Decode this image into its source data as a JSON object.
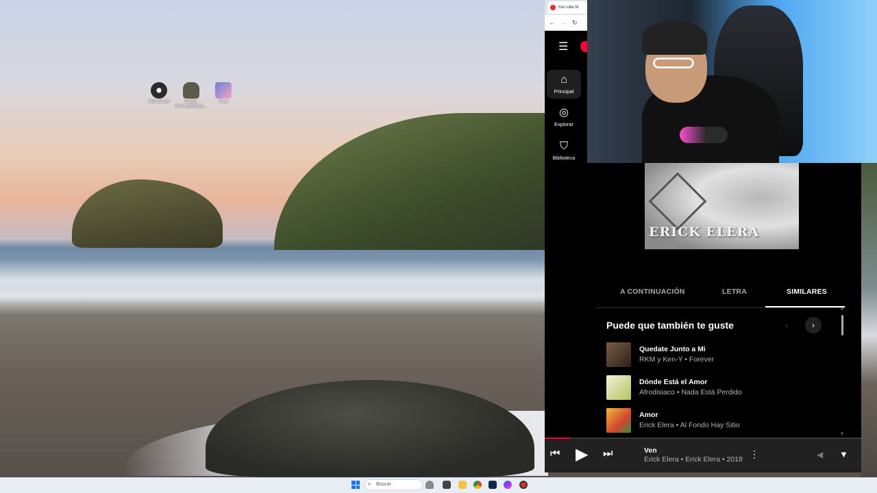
{
  "desktop": {
    "icons": [
      {
        "label": "OBS Studio",
        "icon": "obs-icon",
        "color": "#2b2b2b"
      },
      {
        "label": "PUBG: BATTLEGROU...",
        "icon": "pubg-icon",
        "color": "#5a5a4a"
      },
      {
        "label": "Pixel",
        "icon": "photo-app-icon",
        "color": "#6b7fd6"
      }
    ]
  },
  "browser": {
    "tab_title": "YouTube M",
    "tab_close": "×",
    "nav": {
      "back": "←",
      "forward": "→",
      "reload": "↻"
    }
  },
  "ytmusic": {
    "menu_icon": "☰",
    "sidebar": [
      {
        "label": "Principal",
        "icon": "home-icon",
        "glyph": "⌂"
      },
      {
        "label": "Explorar",
        "icon": "compass-icon",
        "glyph": "◎"
      },
      {
        "label": "Biblioteca",
        "icon": "bookmark-icon",
        "glyph": "⛉"
      }
    ],
    "album_art_text": "ERICK ELERA",
    "tabs": [
      "A CONTINUACIÓN",
      "LETRA",
      "SIMILARES"
    ],
    "active_tab": "SIMILARES",
    "section_title": "Puede que también te guste",
    "carousel": {
      "prev": "‹",
      "next": "›"
    },
    "similar": [
      {
        "title": "Quedate Junto a Mi",
        "subtitle": "RKM y Ken-Y • Forever",
        "thumb_color": "#5b4636"
      },
      {
        "title": "Dónde Está el Amor",
        "subtitle": "Afrodisiaco • Nada Está Perdido",
        "thumb_color": "#c8d08a"
      },
      {
        "title": "Amor",
        "subtitle": "Erick Elera • Al Fondo Hay Sitio",
        "thumb_color": "#e07a2e"
      }
    ],
    "player": {
      "title": "Ven",
      "subtitle": "Erick Elera • Erick Elera • 2018",
      "progress": 0.08,
      "prev": "⏮",
      "play": "▶",
      "next": "⏭",
      "more": "⋮",
      "volume": "◀",
      "expand": "▼"
    }
  },
  "taskbar": {
    "search_placeholder": "Buscar",
    "search_icon": "⌕",
    "apps": [
      {
        "icon": "task-view-icon",
        "color": "#444"
      },
      {
        "icon": "file-explorer-icon",
        "color": "#f4c542"
      },
      {
        "icon": "chrome-icon",
        "color": "#db4437"
      },
      {
        "icon": "photoshop-icon",
        "color": "#0b2a4a"
      },
      {
        "icon": "messenger-icon",
        "color": "#a033ff"
      },
      {
        "icon": "record-icon",
        "color": "#d93025"
      }
    ]
  },
  "colors": {
    "accent": "#ff0033",
    "background": "#000000",
    "player_bg": "#212121"
  }
}
